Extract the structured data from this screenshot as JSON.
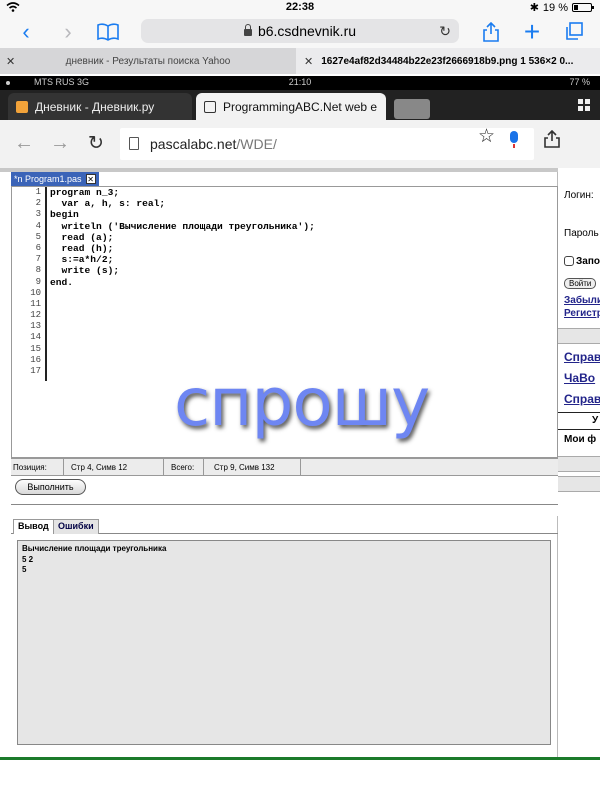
{
  "ios": {
    "time": "22:38",
    "battery": "19 %",
    "address": "b6.csdnevnik.ru",
    "tabs": [
      "дневник - Результаты поиска Yahoo",
      "1627e4af82d34484b22e23f2666918b9.png 1 536×2 0..."
    ]
  },
  "android": {
    "operator": "MTS RUS  3G",
    "time": "21:10",
    "battery": "77 %",
    "tabs": [
      "Дневник - Дневник.ру",
      "ProgrammingABC.Net web e"
    ],
    "url_domain": "pascalabc.net",
    "url_path": "/WDE/"
  },
  "ide": {
    "file_tab": "*n Program1.pas",
    "line_numbers": [
      "1",
      "2",
      "3",
      "4",
      "5",
      "6",
      "7",
      "8",
      "9",
      "10",
      "11",
      "12",
      "13",
      "14",
      "15",
      "16",
      "17"
    ],
    "code_lines": [
      "program n_3;",
      "  var a, h, s: real;",
      "begin",
      "  writeln ('Вычисление площади треугольника');",
      "  read (a);",
      "  read (h);",
      "  s:=a*h/2;",
      "  write (s);",
      "end."
    ],
    "status": {
      "position_label": "Позиция:",
      "position_value": "Стр 4, Симв 12",
      "total_label": "Всего:",
      "total_value": "Стр 9, Симв 132"
    },
    "run_button": "Выполнить",
    "output_tabs": [
      "Вывод",
      "Ошибки"
    ],
    "output_lines": [
      "Вычисление площади треугольника",
      "5 2",
      "5"
    ]
  },
  "sidebar": {
    "login_label": "Логин:",
    "password_label": "Пароль",
    "remember_label": "Запомнить",
    "login_button": "Войти",
    "forgot_link": "Забыли",
    "register_link": "Регистр",
    "links": [
      "Справ",
      "ЧаВо",
      "Справ"
    ],
    "section_title": "У",
    "my_label": "Мои ф"
  },
  "watermark": "спрошу",
  "colors": {
    "ios_accent": "#1a7cf0",
    "file_tab": "#3b64b8",
    "watermark": "#6e86f2",
    "link": "#22248a"
  }
}
